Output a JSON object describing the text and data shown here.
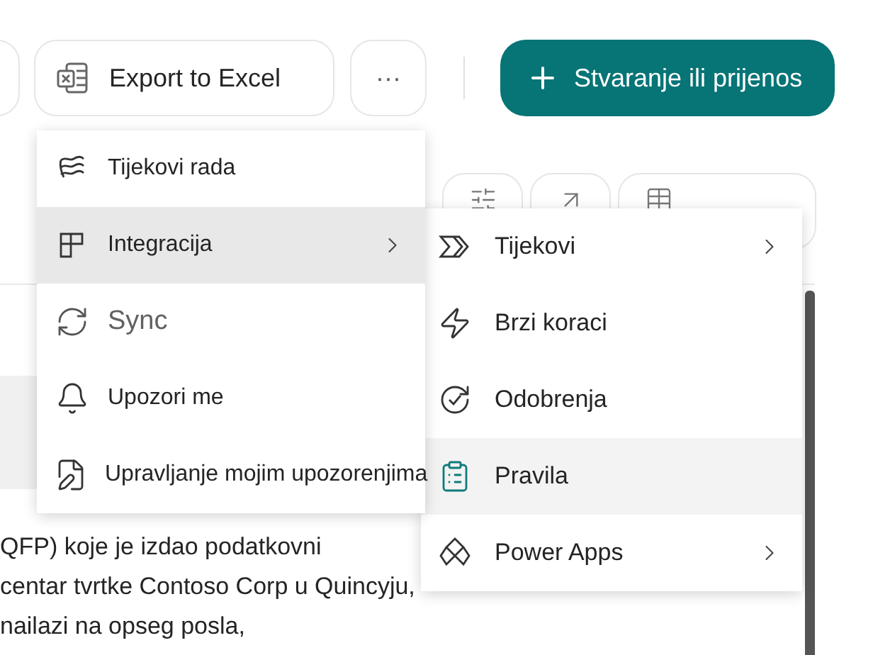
{
  "toolbar": {
    "export_button": "Export to Excel",
    "more_button": "···",
    "create_button": "Stvaranje ili prijenos"
  },
  "menu": {
    "items": [
      {
        "label": "Tijekovi rada",
        "selected": false,
        "disabled": false,
        "has_submenu": false
      },
      {
        "label": "Integracija",
        "selected": true,
        "disabled": false,
        "has_submenu": true
      },
      {
        "label": "Sync",
        "selected": false,
        "disabled": true,
        "has_submenu": false
      },
      {
        "label": "Upozori me",
        "selected": false,
        "disabled": false,
        "has_submenu": false
      },
      {
        "label": "Upravljanje mojim upozorenjima",
        "selected": false,
        "disabled": false,
        "has_submenu": false
      }
    ]
  },
  "submenu": {
    "items": [
      {
        "label": "Tijekovi",
        "selected": false,
        "has_submenu": true
      },
      {
        "label": "Brzi koraci",
        "selected": false,
        "has_submenu": false
      },
      {
        "label": "Odobrenja",
        "selected": false,
        "has_submenu": false
      },
      {
        "label": "Pravila",
        "selected": true,
        "has_submenu": false
      },
      {
        "label": "Power Apps",
        "selected": false,
        "has_submenu": true
      }
    ]
  },
  "body_text": [
    "QFP) koje je izdao podatkovni",
    "centar tvrtke Contoso Corp u Quincyju,",
    "nailazi na opseg posla,"
  ]
}
